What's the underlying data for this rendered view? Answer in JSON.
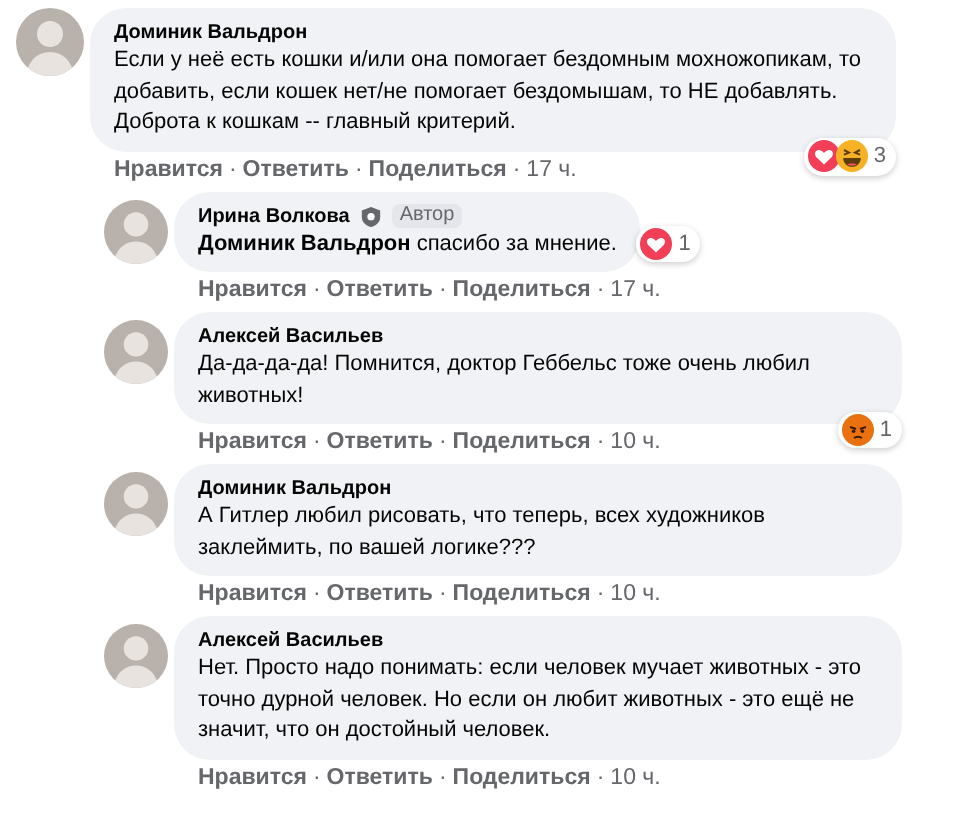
{
  "comments": [
    {
      "author": "Доминик Вальдрон",
      "reply": false,
      "text": "Если у неё есть кошки и/или она помогает бездомным мохножопикам, то добавить, если кошек нет/не помогает бездомышам, то НЕ добавлять. Доброта к кошкам -- главный критерий.",
      "reactions": {
        "icons": [
          {
            "kind": "love"
          },
          {
            "kind": "haha"
          }
        ],
        "count": "3"
      },
      "actions": [
        "Нравится",
        "·",
        "Ответить",
        "·",
        "Поделиться",
        "·",
        "17 ч."
      ]
    },
    {
      "author": "Ирина Волкова",
      "reply": true,
      "badge": "Автор",
      "text": "**Доминик Вальдрон** спасибо за мнение.",
      "reactions": {
        "icons": [
          {
            "kind": "love"
          }
        ],
        "count": "1",
        "beside": true
      },
      "actions": [
        "Нравится",
        "·",
        "Ответить",
        "·",
        "Поделиться",
        "·",
        "17 ч."
      ]
    },
    {
      "author": "Алексей Васильев",
      "reply": true,
      "text": "Да-да-да-да! Помнится, доктор Геббельс тоже очень любил животных!",
      "reactions": {
        "icons": [
          {
            "kind": "angry"
          }
        ],
        "count": "1"
      },
      "actions": [
        "Нравится",
        "·",
        "Ответить",
        "·",
        "Поделиться",
        "·",
        "10 ч."
      ]
    },
    {
      "author": "Доминик Вальдрон",
      "reply": true,
      "text": "А Гитлер любил рисовать, что теперь, всех художников заклеймить, по вашей логике???",
      "actions": [
        "Нравится",
        "·",
        "Ответить",
        "·",
        "Поделиться",
        "·",
        "10 ч."
      ]
    },
    {
      "author": "Алексей Васильев",
      "reply": true,
      "text": "Нет. Просто надо понимать: если человек мучает животных - это точно дурной человек. Но если он любит животных - это ещё не значит, что он достойный человек.",
      "actions": [
        "Нравится",
        "·",
        "Ответить",
        "·",
        "Поделиться",
        "·",
        "10 ч."
      ]
    }
  ]
}
